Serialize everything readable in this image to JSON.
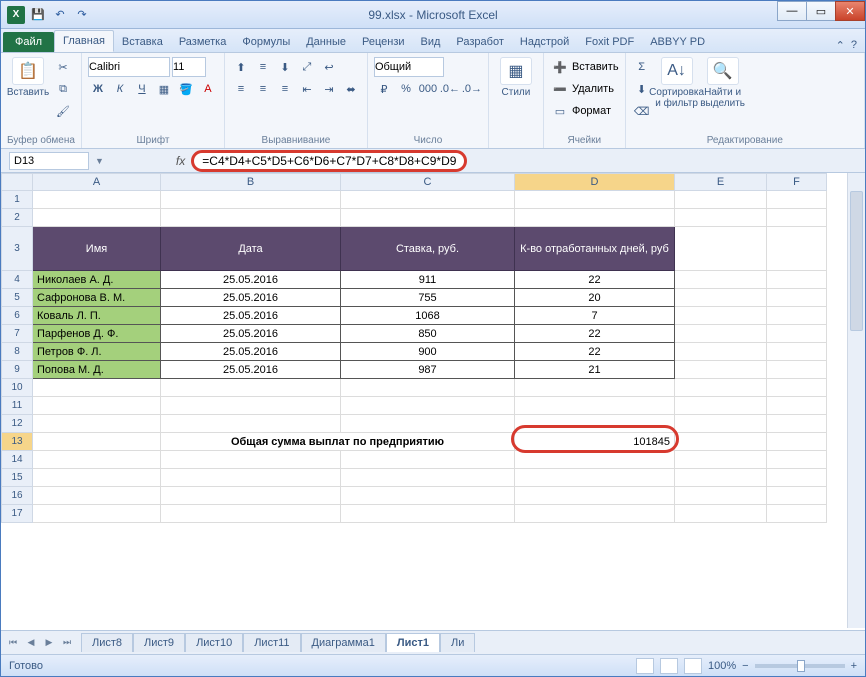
{
  "title": "99.xlsx - Microsoft Excel",
  "qat": {
    "save": "💾",
    "undo": "↶",
    "redo": "↷"
  },
  "tabs": {
    "file": "Файл",
    "items": [
      "Главная",
      "Вставка",
      "Разметка",
      "Формулы",
      "Данные",
      "Рецензи",
      "Вид",
      "Разработ",
      "Надстрой",
      "Foxit PDF",
      "ABBYY PD"
    ],
    "active": 0
  },
  "ribbon": {
    "clipboard": {
      "paste": "Вставить",
      "label": "Буфер обмена"
    },
    "font": {
      "name": "Calibri",
      "size": "11",
      "label": "Шрифт"
    },
    "alignment": {
      "label": "Выравнивание"
    },
    "number": {
      "format": "Общий",
      "label": "Число"
    },
    "styles": {
      "btn": "Стили",
      "label": ""
    },
    "cells": {
      "insert": "Вставить",
      "delete": "Удалить",
      "format": "Формат",
      "label": "Ячейки"
    },
    "editing": {
      "sort": "Сортировка и фильтр",
      "find": "Найти и выделить",
      "label": "Редактирование"
    }
  },
  "namebox": "D13",
  "formula": "=C4*D4+C5*D5+C6*D6+C7*D7+C8*D8+C9*D9",
  "columns": [
    "A",
    "B",
    "C",
    "D",
    "E",
    "F"
  ],
  "rownums": [
    "1",
    "2",
    "3",
    "4",
    "5",
    "6",
    "7",
    "8",
    "9",
    "10",
    "11",
    "12",
    "13",
    "14",
    "15",
    "16",
    "17"
  ],
  "headers": {
    "name": "Имя",
    "date": "Дата",
    "rate": "Ставка, руб.",
    "days": "К-во отработанных дней, руб"
  },
  "data": [
    {
      "name": "Николаев А. Д.",
      "date": "25.05.2016",
      "rate": "911",
      "days": "22"
    },
    {
      "name": "Сафронова В. М.",
      "date": "25.05.2016",
      "rate": "755",
      "days": "20"
    },
    {
      "name": "Коваль Л. П.",
      "date": "25.05.2016",
      "rate": "1068",
      "days": "7"
    },
    {
      "name": "Парфенов Д. Ф.",
      "date": "25.05.2016",
      "rate": "850",
      "days": "22"
    },
    {
      "name": "Петров Ф. Л.",
      "date": "25.05.2016",
      "rate": "900",
      "days": "22"
    },
    {
      "name": "Попова М. Д.",
      "date": "25.05.2016",
      "rate": "987",
      "days": "21"
    }
  ],
  "total": {
    "label": "Общая сумма выплат по предприятию",
    "value": "101845"
  },
  "sheets": [
    "Лист8",
    "Лист9",
    "Лист10",
    "Лист11",
    "Диаграмма1",
    "Лист1",
    "Ли"
  ],
  "sheet_active": 5,
  "status": {
    "ready": "Готово",
    "zoom": "100%"
  }
}
